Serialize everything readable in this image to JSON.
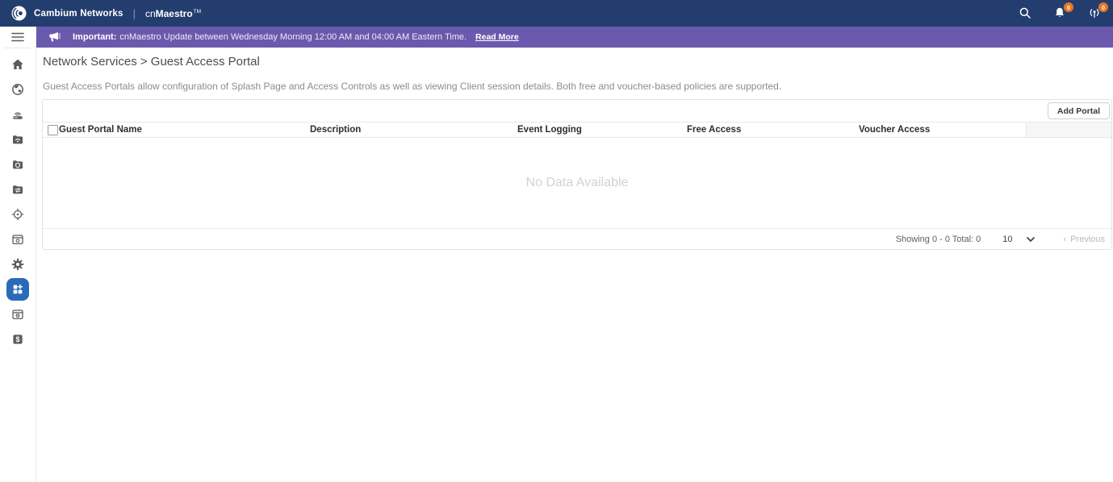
{
  "topbar": {
    "brand": "Cambium Networks",
    "separator": "|",
    "product_prefix": "cn",
    "product_bold": "Maestro",
    "trademark": "TM",
    "alarms_badge": "0",
    "announcements_badge": "0"
  },
  "banner": {
    "label": "Important:",
    "message": "cnMaestro Update between Wednesday Morning 12:00 AM and 04:00 AM Eastern Time.",
    "link_label": "Read More"
  },
  "breadcrumb": {
    "text": "Network Services > Guest Access Portal"
  },
  "main": {
    "description": "Guest Access Portals allow configuration of Splash Page and Access Controls as well as viewing Client session details. Both free and voucher-based policies are supported.",
    "add_portal_label": "Add Portal",
    "empty_message": "No Data Available"
  },
  "table": {
    "headers": [
      "Guest Portal Name",
      "Description",
      "Event Logging",
      "Free Access",
      "Voucher Access"
    ]
  },
  "pagination": {
    "summary": "Showing 0 - 0 Total: 0",
    "page_size": "10",
    "previous_arrow": "‹",
    "previous": "Previous"
  },
  "sidebar": {
    "icons": [
      "hamburger-menu",
      "home",
      "globe-monitor",
      "access-point",
      "folder-wifi",
      "folder-shield",
      "folder-switch",
      "crosshair-onboard",
      "window-report",
      "gear-settings",
      "services-apps",
      "window-admin",
      "subscription-dollar"
    ],
    "active_item": "services-apps"
  },
  "colors": {
    "topbar_bg": "#233e6e",
    "banner_bg": "#6a5aad",
    "active_item_bg": "#2a6bb7",
    "badge_bg": "#e87722"
  }
}
